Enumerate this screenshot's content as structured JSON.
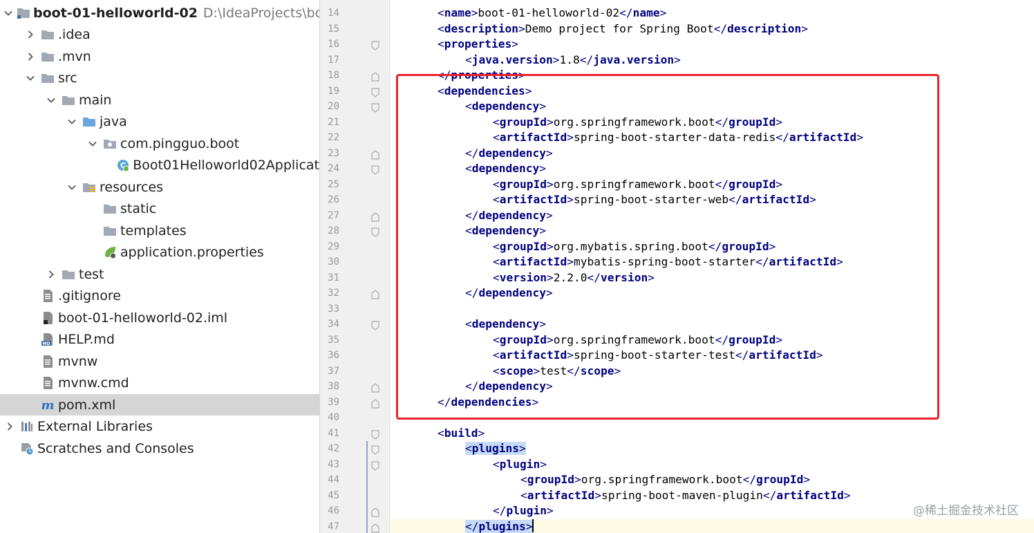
{
  "project_tree": {
    "items": [
      {
        "label": "boot-01-helloworld-02",
        "path": "D:\\IdeaProjects\\boot-",
        "depth": 0,
        "arrow": "down",
        "icon": "module-folder-icon",
        "bold": true
      },
      {
        "label": ".idea",
        "depth": 1,
        "arrow": "right",
        "icon": "folder-icon"
      },
      {
        "label": ".mvn",
        "depth": 1,
        "arrow": "right",
        "icon": "folder-icon"
      },
      {
        "label": "src",
        "depth": 1,
        "arrow": "down",
        "icon": "folder-icon"
      },
      {
        "label": "main",
        "depth": 2,
        "arrow": "down",
        "icon": "folder-icon"
      },
      {
        "label": "java",
        "depth": 3,
        "arrow": "down",
        "icon": "source-folder-icon"
      },
      {
        "label": "com.pingguo.boot",
        "depth": 4,
        "arrow": "down",
        "icon": "package-icon"
      },
      {
        "label": "Boot01Helloworld02Applicat",
        "depth": 5,
        "arrow": "none",
        "icon": "spring-boot-class-icon"
      },
      {
        "label": "resources",
        "depth": 3,
        "arrow": "down",
        "icon": "resources-folder-icon"
      },
      {
        "label": "static",
        "depth": 4,
        "arrow": "none",
        "icon": "folder-icon"
      },
      {
        "label": "templates",
        "depth": 4,
        "arrow": "none",
        "icon": "folder-icon"
      },
      {
        "label": "application.properties",
        "depth": 4,
        "arrow": "none",
        "icon": "spring-properties-icon"
      },
      {
        "label": "test",
        "depth": 2,
        "arrow": "right",
        "icon": "folder-icon"
      },
      {
        "label": ".gitignore",
        "depth": 1,
        "arrow": "none",
        "icon": "text-file-icon"
      },
      {
        "label": "boot-01-helloworld-02.iml",
        "depth": 1,
        "arrow": "none",
        "icon": "iml-file-icon"
      },
      {
        "label": "HELP.md",
        "depth": 1,
        "arrow": "none",
        "icon": "markdown-file-icon"
      },
      {
        "label": "mvnw",
        "depth": 1,
        "arrow": "none",
        "icon": "text-file-icon"
      },
      {
        "label": "mvnw.cmd",
        "depth": 1,
        "arrow": "none",
        "icon": "text-file-icon"
      },
      {
        "label": "pom.xml",
        "depth": 1,
        "arrow": "none",
        "icon": "maven-file-icon",
        "selected": true
      },
      {
        "label": "External Libraries",
        "depth": 0,
        "arrow": "right",
        "icon": "libraries-icon"
      },
      {
        "label": "Scratches and Consoles",
        "depth": 0,
        "arrow": "none",
        "icon": "scratches-icon"
      }
    ]
  },
  "editor": {
    "lines": [
      {
        "n": "14",
        "indent": 1,
        "tokens": [
          [
            "t",
            "name"
          ],
          [
            "x",
            "boot-01-helloworld-02"
          ],
          [
            "c",
            "name"
          ]
        ]
      },
      {
        "n": "15",
        "indent": 1,
        "tokens": [
          [
            "t",
            "description"
          ],
          [
            "x",
            "Demo project for Spring Boot"
          ],
          [
            "c",
            "description"
          ]
        ]
      },
      {
        "n": "16",
        "indent": 1,
        "tokens": [
          [
            "t",
            "properties"
          ]
        ],
        "fold": "open"
      },
      {
        "n": "17",
        "indent": 2,
        "tokens": [
          [
            "t",
            "java.version"
          ],
          [
            "x",
            "1.8"
          ],
          [
            "c",
            "java.version"
          ]
        ]
      },
      {
        "n": "18",
        "indent": 1,
        "tokens": [
          [
            "c",
            "properties"
          ]
        ],
        "fold": "close"
      },
      {
        "n": "19",
        "indent": 1,
        "tokens": [
          [
            "t",
            "dependencies"
          ]
        ],
        "fold": "open"
      },
      {
        "n": "20",
        "indent": 2,
        "tokens": [
          [
            "t",
            "dependency"
          ]
        ],
        "fold": "open"
      },
      {
        "n": "21",
        "indent": 3,
        "tokens": [
          [
            "t",
            "groupId"
          ],
          [
            "x",
            "org.springframework.boot"
          ],
          [
            "c",
            "groupId"
          ]
        ]
      },
      {
        "n": "22",
        "indent": 3,
        "tokens": [
          [
            "t",
            "artifactId"
          ],
          [
            "x",
            "spring-boot-starter-data-redis"
          ],
          [
            "c",
            "artifactId"
          ]
        ]
      },
      {
        "n": "23",
        "indent": 2,
        "tokens": [
          [
            "c",
            "dependency"
          ]
        ],
        "fold": "close"
      },
      {
        "n": "24",
        "indent": 2,
        "tokens": [
          [
            "t",
            "dependency"
          ]
        ],
        "fold": "open"
      },
      {
        "n": "25",
        "indent": 3,
        "tokens": [
          [
            "t",
            "groupId"
          ],
          [
            "x",
            "org.springframework.boot"
          ],
          [
            "c",
            "groupId"
          ]
        ]
      },
      {
        "n": "26",
        "indent": 3,
        "tokens": [
          [
            "t",
            "artifactId"
          ],
          [
            "x",
            "spring-boot-starter-web"
          ],
          [
            "c",
            "artifactId"
          ]
        ]
      },
      {
        "n": "27",
        "indent": 2,
        "tokens": [
          [
            "c",
            "dependency"
          ]
        ],
        "fold": "close"
      },
      {
        "n": "28",
        "indent": 2,
        "tokens": [
          [
            "t",
            "dependency"
          ]
        ],
        "fold": "open"
      },
      {
        "n": "29",
        "indent": 3,
        "tokens": [
          [
            "t",
            "groupId"
          ],
          [
            "x",
            "org.mybatis.spring.boot"
          ],
          [
            "c",
            "groupId"
          ]
        ]
      },
      {
        "n": "30",
        "indent": 3,
        "tokens": [
          [
            "t",
            "artifactId"
          ],
          [
            "x",
            "mybatis-spring-boot-starter"
          ],
          [
            "c",
            "artifactId"
          ]
        ]
      },
      {
        "n": "31",
        "indent": 3,
        "tokens": [
          [
            "t",
            "version"
          ],
          [
            "x",
            "2.2.0"
          ],
          [
            "c",
            "version"
          ]
        ]
      },
      {
        "n": "32",
        "indent": 2,
        "tokens": [
          [
            "c",
            "dependency"
          ]
        ],
        "fold": "close"
      },
      {
        "n": "33",
        "indent": 0,
        "tokens": []
      },
      {
        "n": "34",
        "indent": 2,
        "tokens": [
          [
            "t",
            "dependency"
          ]
        ],
        "fold": "open"
      },
      {
        "n": "35",
        "indent": 3,
        "tokens": [
          [
            "t",
            "groupId"
          ],
          [
            "x",
            "org.springframework.boot"
          ],
          [
            "c",
            "groupId"
          ]
        ]
      },
      {
        "n": "36",
        "indent": 3,
        "tokens": [
          [
            "t",
            "artifactId"
          ],
          [
            "x",
            "spring-boot-starter-test"
          ],
          [
            "c",
            "artifactId"
          ]
        ]
      },
      {
        "n": "37",
        "indent": 3,
        "tokens": [
          [
            "t",
            "scope"
          ],
          [
            "x",
            "test"
          ],
          [
            "c",
            "scope"
          ]
        ]
      },
      {
        "n": "38",
        "indent": 2,
        "tokens": [
          [
            "c",
            "dependency"
          ]
        ],
        "fold": "close"
      },
      {
        "n": "39",
        "indent": 1,
        "tokens": [
          [
            "c",
            "dependencies"
          ]
        ],
        "fold": "close"
      },
      {
        "n": "40",
        "indent": 0,
        "tokens": []
      },
      {
        "n": "41",
        "indent": 1,
        "tokens": [
          [
            "t",
            "build"
          ]
        ],
        "fold": "open"
      },
      {
        "n": "42",
        "indent": 2,
        "tokens": [
          [
            "t",
            "plugins"
          ]
        ],
        "fold": "open",
        "highlight": true
      },
      {
        "n": "43",
        "indent": 3,
        "tokens": [
          [
            "t",
            "plugin"
          ]
        ],
        "fold": "open"
      },
      {
        "n": "44",
        "indent": 4,
        "tokens": [
          [
            "t",
            "groupId"
          ],
          [
            "x",
            "org.springframework.boot"
          ],
          [
            "c",
            "groupId"
          ]
        ]
      },
      {
        "n": "45",
        "indent": 4,
        "tokens": [
          [
            "t",
            "artifactId"
          ],
          [
            "x",
            "spring-boot-maven-plugin"
          ],
          [
            "c",
            "artifactId"
          ]
        ]
      },
      {
        "n": "46",
        "indent": 3,
        "tokens": [
          [
            "c",
            "plugin"
          ]
        ],
        "fold": "close"
      },
      {
        "n": "47",
        "indent": 2,
        "tokens": [
          [
            "c",
            "plugins"
          ]
        ],
        "fold": "close",
        "highlight": true,
        "caret": true
      }
    ]
  },
  "watermark": "@稀土掘金技术社区",
  "colors": {
    "tag": "#000080",
    "highlight": "#c6dbf5",
    "red_box": "#e8232b",
    "selection": "#d5d5d5",
    "folder": "#a3a9b3",
    "source_folder": "#6aa6e0"
  }
}
